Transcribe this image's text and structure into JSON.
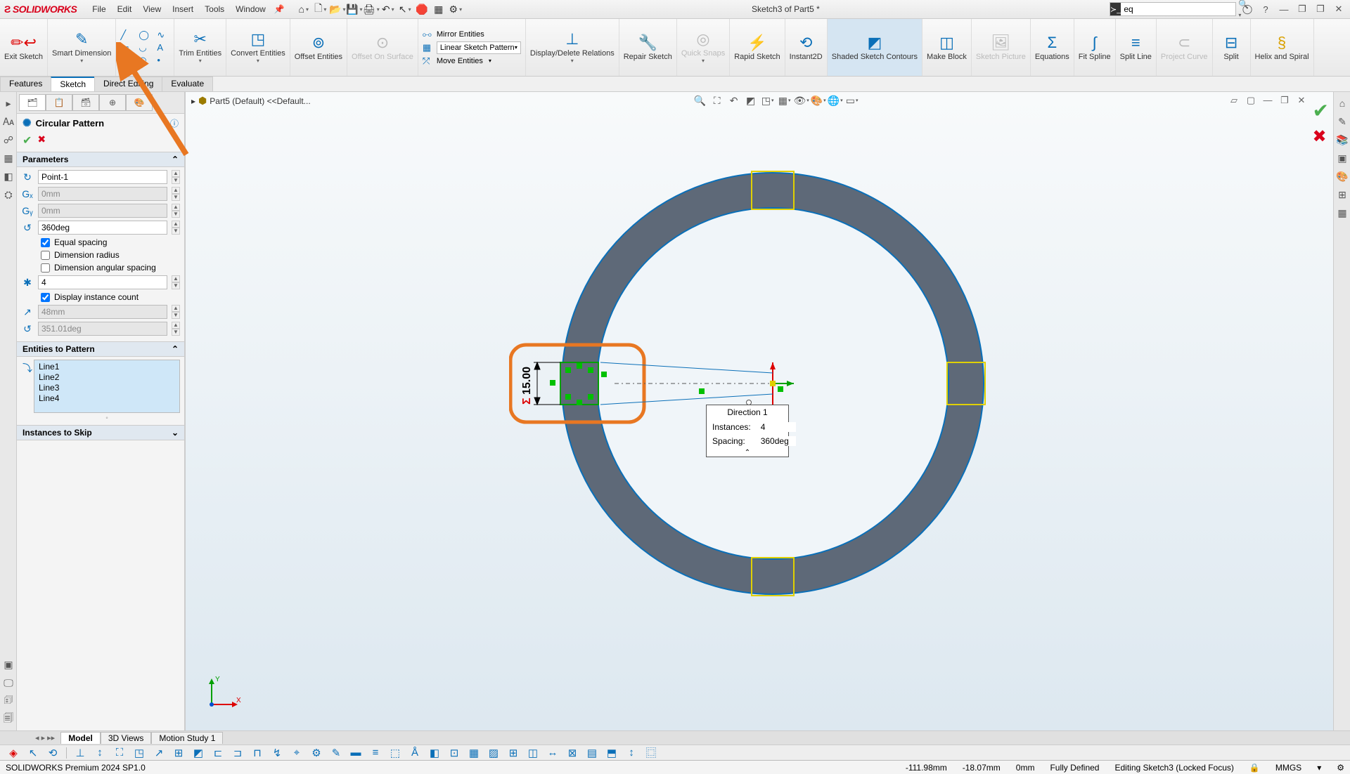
{
  "title": {
    "brand": "SOLIDWORKS",
    "menus": [
      "File",
      "Edit",
      "View",
      "Insert",
      "Tools",
      "Window"
    ],
    "doc": "Sketch3 of Part5 *",
    "search_placeholder": "eq"
  },
  "ribbon": {
    "exit_sketch": "Exit Sketch",
    "smart_dim": "Smart Dimension",
    "trim": "Trim Entities",
    "convert": "Convert Entities",
    "offset": "Offset Entities",
    "offset_surf": "Offset On Surface",
    "mirror": "Mirror Entities",
    "linear_pattern": "Linear Sketch Pattern",
    "move": "Move Entities",
    "disp_del": "Display/Delete Relations",
    "repair": "Repair Sketch",
    "quick": "Quick Snaps",
    "rapid": "Rapid Sketch",
    "instant": "Instant2D",
    "shaded": "Shaded Sketch Contours",
    "make_block": "Make Block",
    "sketch_pic": "Sketch Picture",
    "equations": "Equations",
    "fit_spline": "Fit Spline",
    "split_line": "Split Line",
    "project_curve": "Project Curve",
    "split": "Split",
    "helix": "Helix and Spiral"
  },
  "tabs": [
    "Features",
    "Sketch",
    "Direct Editing",
    "Evaluate"
  ],
  "active_tab": "Sketch",
  "breadcrumb": "Part5 (Default) <<Default...",
  "prop": {
    "title": "Circular Pattern",
    "parameters": "Parameters",
    "point": "Point-1",
    "centerx": "0mm",
    "centery": "0mm",
    "angle": "360deg",
    "equal_spacing": "Equal spacing",
    "dim_radius": "Dimension radius",
    "dim_angular": "Dimension angular spacing",
    "instances": "4",
    "disp_count": "Display instance count",
    "radius": "48mm",
    "arc_angle": "351.01deg",
    "entities_hdr": "Entities to Pattern",
    "entities": [
      "Line1",
      "Line2",
      "Line3",
      "Line4"
    ],
    "skip": "Instances to Skip"
  },
  "dirbox": {
    "title": "Direction 1",
    "instances_lbl": "Instances:",
    "instances_val": "4",
    "spacing_lbl": "Spacing:",
    "spacing_val": "360deg"
  },
  "dim_label": "15.00",
  "bottom_tabs": [
    "Model",
    "3D Views",
    "Motion Study 1"
  ],
  "active_btm": "Model",
  "status": {
    "product": "SOLIDWORKS Premium 2024 SP1.0",
    "coord_x": "-111.98mm",
    "coord_y": "-18.07mm",
    "coord_z": "0mm",
    "defined": "Fully Defined",
    "editing": "Editing Sketch3 (Locked Focus)",
    "units": "MMGS"
  }
}
